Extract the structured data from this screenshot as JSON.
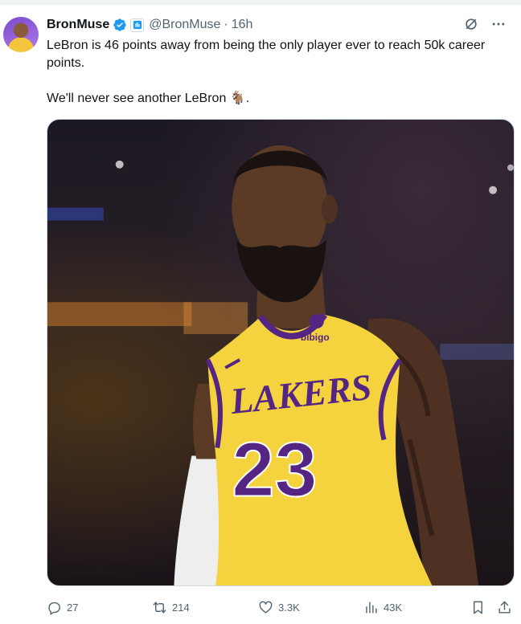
{
  "tweet": {
    "author_name": "BronMuse",
    "handle": "@BronMuse",
    "separator": "·",
    "time": "16h",
    "text_line1": "LeBron is 46 points away from being the only player ever to reach 50k career points.",
    "text_line2": "We'll never see another LeBron",
    "text_emoji": "🐐",
    "text_end": "."
  },
  "media": {
    "jersey_brand": "LAKERS",
    "jersey_number": "23",
    "sponsor": "bibigo"
  },
  "actions": {
    "replies": "27",
    "reposts": "214",
    "likes": "3.3K",
    "views": "43K"
  },
  "icons": {
    "verified": "verified-badge-icon",
    "affiliation": "affiliation-badge-icon",
    "grok": "grok-icon",
    "more": "more-icon",
    "reply": "reply-icon",
    "repost": "repost-icon",
    "like": "like-icon",
    "views": "views-icon",
    "bookmark": "bookmark-icon",
    "share": "share-icon"
  },
  "colors": {
    "verified_blue": "#1d9bf0",
    "secondary_text": "#536471",
    "lakers_gold": "#f5d33e",
    "lakers_purple": "#552583"
  }
}
